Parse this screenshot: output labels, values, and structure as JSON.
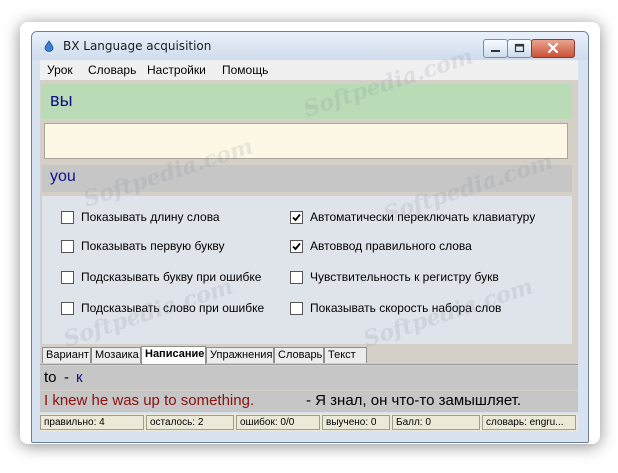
{
  "window": {
    "title": "BX Language acquisition"
  },
  "menu": {
    "items": [
      "Урок",
      "Словарь",
      "Настройки",
      "Помощь"
    ]
  },
  "lesson": {
    "word": "вы",
    "answer_value": "",
    "translation": "you"
  },
  "options": [
    {
      "label": "Показывать длину слова",
      "checked": false
    },
    {
      "label": "Показывать первую букву",
      "checked": false
    },
    {
      "label": "Подсказывать букву при ошибке",
      "checked": false
    },
    {
      "label": "Подсказывать слово при ошибке",
      "checked": false
    },
    {
      "label": "Автоматически переключать клавиатуру",
      "checked": true
    },
    {
      "label": "Автоввод правильного слова",
      "checked": true
    },
    {
      "label": "Чувствительность к регистру букв",
      "checked": false
    },
    {
      "label": "Показывать скорость набора слов",
      "checked": false
    }
  ],
  "tabs": [
    {
      "label": "Вариант",
      "active": false
    },
    {
      "label": "Мозаика",
      "active": false
    },
    {
      "label": "Написание",
      "active": true
    },
    {
      "label": "Упражнения",
      "active": false
    },
    {
      "label": "Словарь",
      "active": false
    },
    {
      "label": "Текст",
      "active": false
    }
  ],
  "pair": {
    "english": "to",
    "separator": "-",
    "hint": "к"
  },
  "example": {
    "english": "I knew he was up to something.",
    "russian": "- Я знал, он что-то замышляет."
  },
  "status": {
    "correct": "правильно: 4",
    "remaining": "осталось: 2",
    "errors": "ошибок: 0/0",
    "learned": "выучено: 0",
    "score": "Балл: 0",
    "dictionary": "словарь: engru..."
  },
  "watermark": "Softpedia.com",
  "colors": {
    "word_panel": "#b9dcb6",
    "answer_bg": "#fdf7e6",
    "word_text": "#101090",
    "example_en": "#8b1010"
  }
}
